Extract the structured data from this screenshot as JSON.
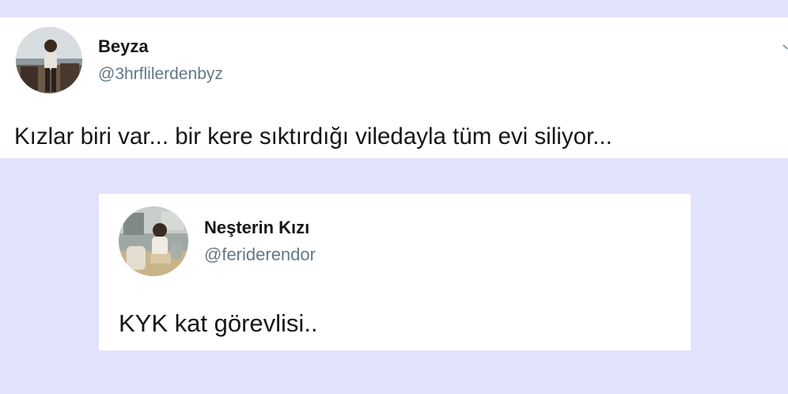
{
  "main_tweet": {
    "author_name": "Beyza",
    "author_handle": "@3hrflilerdenbyz",
    "text": "Kızlar biri var... bir kere sıktırdığı viledayla tüm evi siliyor..."
  },
  "reply_tweet": {
    "author_name": "Neşterin Kızı",
    "author_handle": "@feriderendor",
    "text": "KYK kat görevlisi.."
  },
  "colors": {
    "background": "#e1e3fd",
    "card": "#ffffff",
    "name_text": "#14171a",
    "handle_text": "#657786"
  },
  "icons": {
    "more_menu": "chevron-down-icon"
  }
}
